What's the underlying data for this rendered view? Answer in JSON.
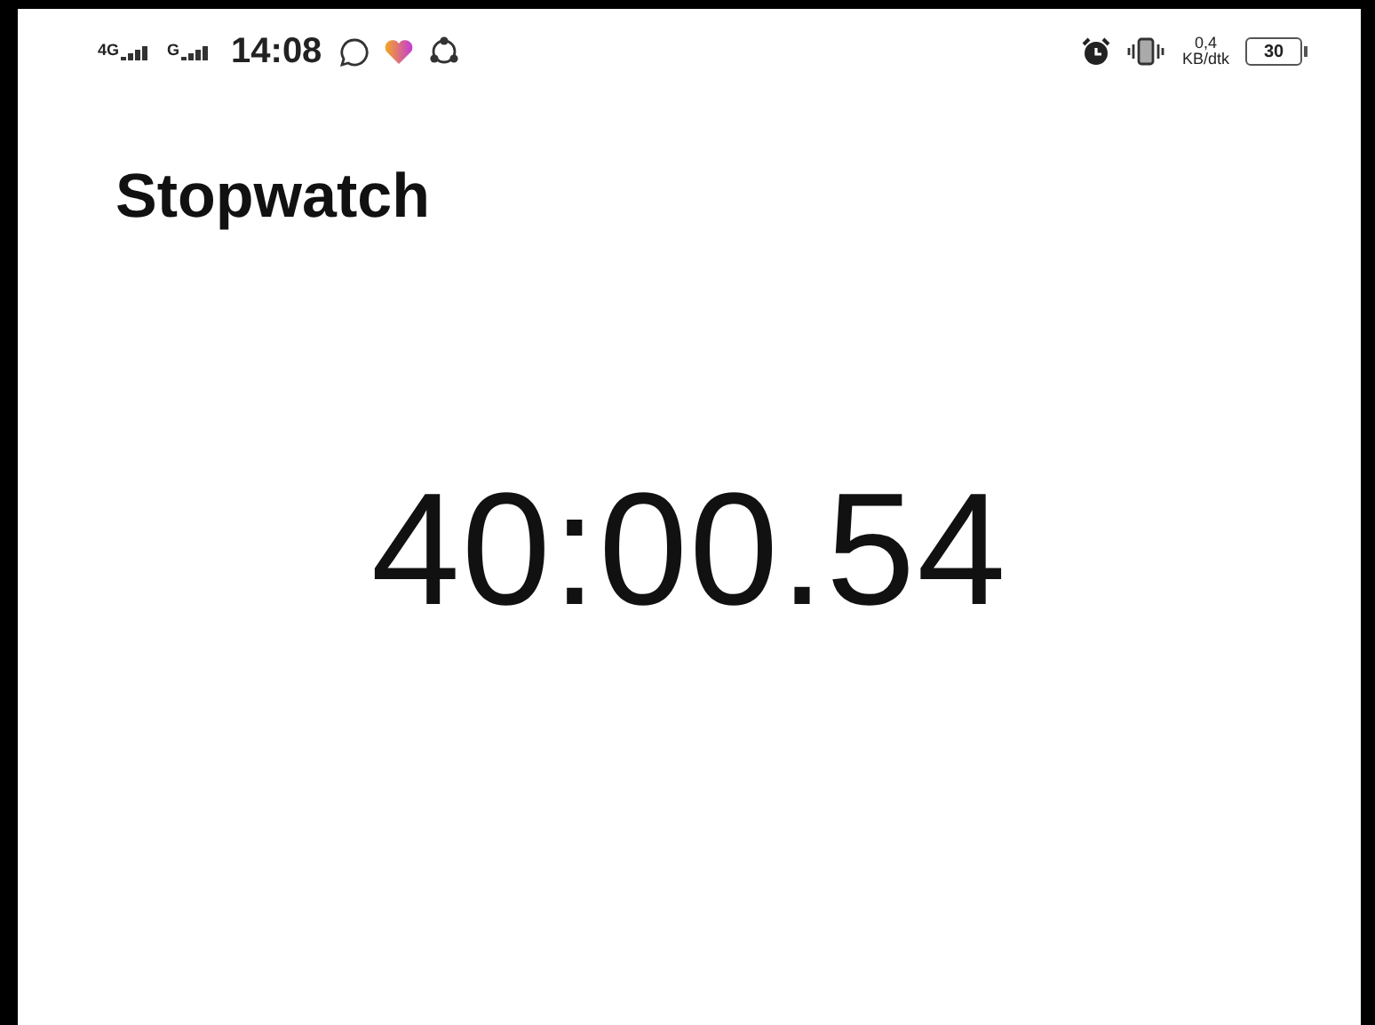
{
  "status_bar": {
    "network_1": "4G",
    "network_2": "G",
    "time": "14:08",
    "speed_value": "0,4",
    "speed_unit": "KB/dtk",
    "battery": "30"
  },
  "title": "Stopwatch",
  "elapsed": "40:00.54"
}
